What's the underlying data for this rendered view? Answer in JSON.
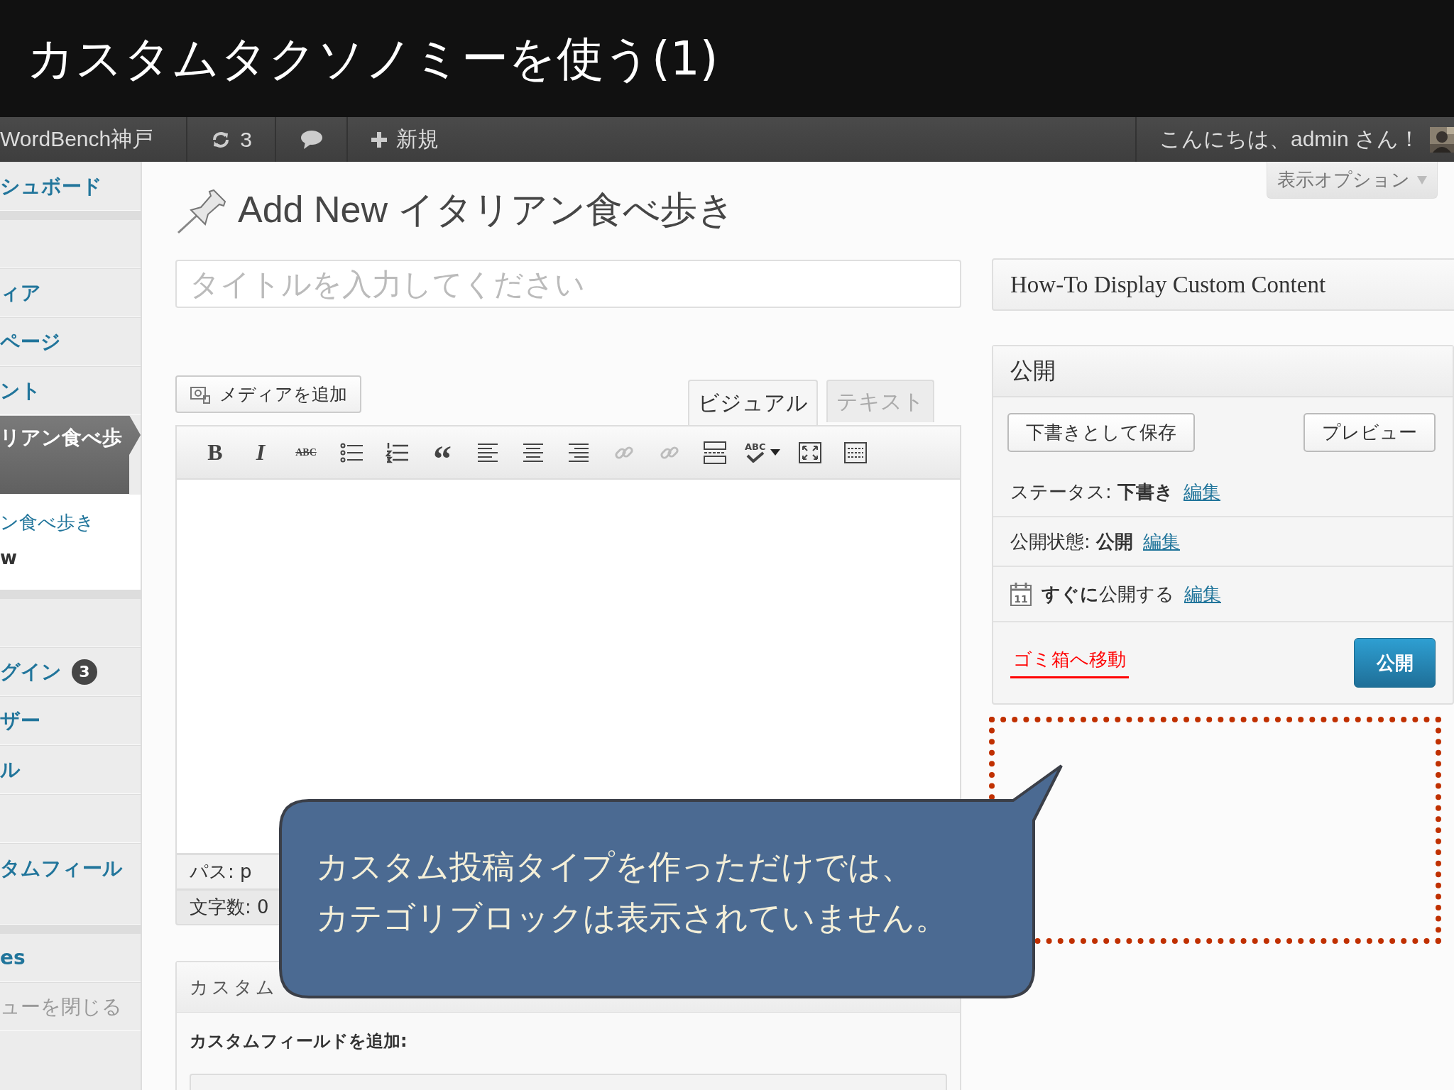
{
  "slide_title": "カスタムタクソノミーを使う(1)",
  "admin_bar": {
    "site": "WordBench神戸",
    "updates": "3",
    "new_label": "新規",
    "greeting": "こんにちは、admin さん！"
  },
  "screen_options": "表示オプション",
  "sidebar": {
    "groups": [
      [
        {
          "kind": "menu",
          "label": "シュボード",
          "selected": false
        }
      ],
      [
        {
          "kind": "blank"
        },
        {
          "kind": "menu",
          "label": "ィア",
          "selected": false
        },
        {
          "kind": "menu",
          "label": "ページ",
          "selected": false
        },
        {
          "kind": "menu",
          "label": "ント",
          "selected": false
        },
        {
          "kind": "menu",
          "label": "リアン食べ歩",
          "selected": true,
          "children": [
            {
              "kind": "sub",
              "label": "ン食べ歩き",
              "selected": false
            },
            {
              "kind": "sub",
              "label": "w",
              "selected": true
            }
          ]
        }
      ],
      [
        {
          "kind": "blank"
        },
        {
          "kind": "menu",
          "label": "グイン",
          "badge": "3",
          "selected": false
        },
        {
          "kind": "menu",
          "label": "ザー",
          "selected": false
        },
        {
          "kind": "menu",
          "label": "ル",
          "selected": false
        },
        {
          "kind": "blank"
        },
        {
          "kind": "menu",
          "label": "タムフィール",
          "selected": false,
          "tall": true
        }
      ],
      [
        {
          "kind": "menu",
          "label": "es",
          "selected": false
        },
        {
          "kind": "collapse",
          "label": "ューを閉じる"
        }
      ]
    ]
  },
  "page_heading": "Add New イタリアン食べ歩き",
  "title_field": {
    "placeholder": "タイトルを入力してください"
  },
  "media_button": "メディアを追加",
  "editor_tabs": [
    {
      "label": "ビジュアル",
      "selected": true
    },
    {
      "label": "テキスト",
      "selected": false
    }
  ],
  "toolbar": [
    {
      "kind": "bold",
      "label": "B",
      "disabled": false
    },
    {
      "kind": "italic",
      "label": "I",
      "disabled": false
    },
    {
      "kind": "strike",
      "label": "ABC",
      "disabled": false
    },
    {
      "kind": "bullets",
      "disabled": false
    },
    {
      "kind": "numbers",
      "disabled": false
    },
    {
      "kind": "quote",
      "label": "“",
      "disabled": false
    },
    {
      "kind": "align-left",
      "disabled": false
    },
    {
      "kind": "align-center",
      "disabled": false
    },
    {
      "kind": "align-right",
      "disabled": false
    },
    {
      "kind": "link",
      "disabled": true
    },
    {
      "kind": "unlink",
      "disabled": true
    },
    {
      "kind": "more",
      "disabled": false
    },
    {
      "kind": "spell",
      "label": "ABC",
      "disabled": false
    },
    {
      "kind": "fullscreen",
      "disabled": false
    },
    {
      "kind": "kitchen",
      "disabled": false
    }
  ],
  "editor_status": {
    "path": "パス: p",
    "word_count": "文字数: 0"
  },
  "custom_fields": {
    "title": "カスタム",
    "add_label": "カスタムフィールドを追加:"
  },
  "howto_box": {
    "title": "How-To Display Custom Content"
  },
  "publish": {
    "title": "公開",
    "save_draft": "下書きとして保存",
    "preview": "プレビュー",
    "rows": [
      {
        "kind": "status",
        "text": "ステータス: **下書き**",
        "link": "編集"
      },
      {
        "kind": "visibility",
        "text": "公開状態: **公開**",
        "link": "編集"
      },
      {
        "kind": "schedule",
        "icon_text": "11",
        "text": "**すぐに**公開する",
        "link": "編集"
      }
    ],
    "trash": "ゴミ箱へ移動",
    "publish_button": "公開"
  },
  "callout": {
    "lines": [
      "カスタム投稿タイプを作っただけでは、",
      "カテゴリブロックは表示されていません。"
    ]
  }
}
